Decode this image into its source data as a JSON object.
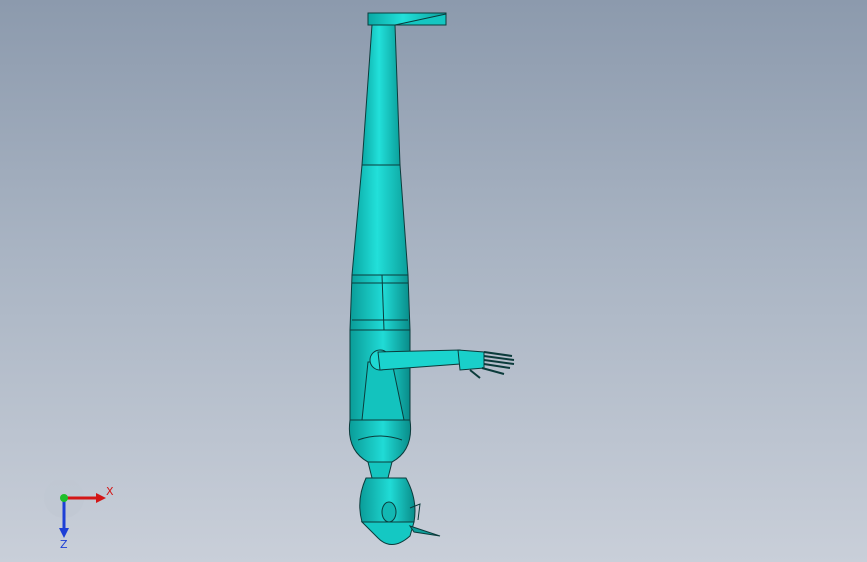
{
  "viewport": {
    "background_top": "#8c9aad",
    "background_bottom": "#c9cfd9"
  },
  "model": {
    "name": "",
    "color": "#1fd6d1",
    "edge_color": "#0b3b3b"
  },
  "triad": {
    "x_label": "X",
    "z_label": "Z",
    "x_color": "#d31616",
    "y_color": "#1fbf2a",
    "z_color": "#1d3fd6"
  }
}
